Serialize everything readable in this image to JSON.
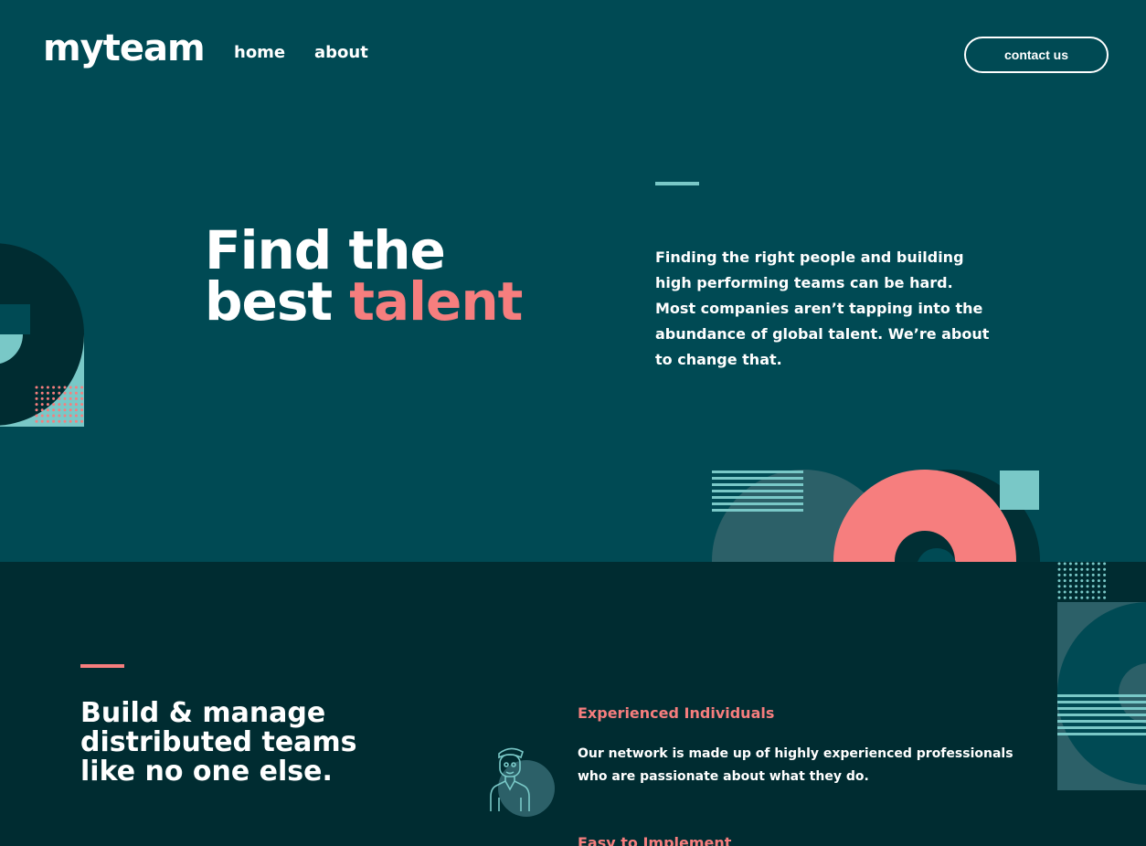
{
  "nav": {
    "logo": "myteam",
    "links": [
      {
        "label": "home"
      },
      {
        "label": "about"
      }
    ],
    "contact_label": "contact us"
  },
  "hero": {
    "title_line1": "Find the",
    "title_line2_plain": "best ",
    "title_line2_accent": "talent",
    "description": "Finding the right people and building high performing teams can be hard. Most companies aren’t tapping into the abundance of global talent. We’re about to change that."
  },
  "features_section": {
    "title": "Build & manage distributed teams like no one else.",
    "features": [
      {
        "title": "Experienced Individuals",
        "text": "Our network is made up of highly experienced professionals who are passionate about what they do.",
        "icon": "person-icon"
      },
      {
        "title": "Easy to Implement"
      }
    ]
  },
  "colors": {
    "hero_bg": "#004a54",
    "dark_bg": "#002c31",
    "coral": "#f67e7e",
    "teal": "#79c8c7",
    "white": "#ffffff"
  }
}
